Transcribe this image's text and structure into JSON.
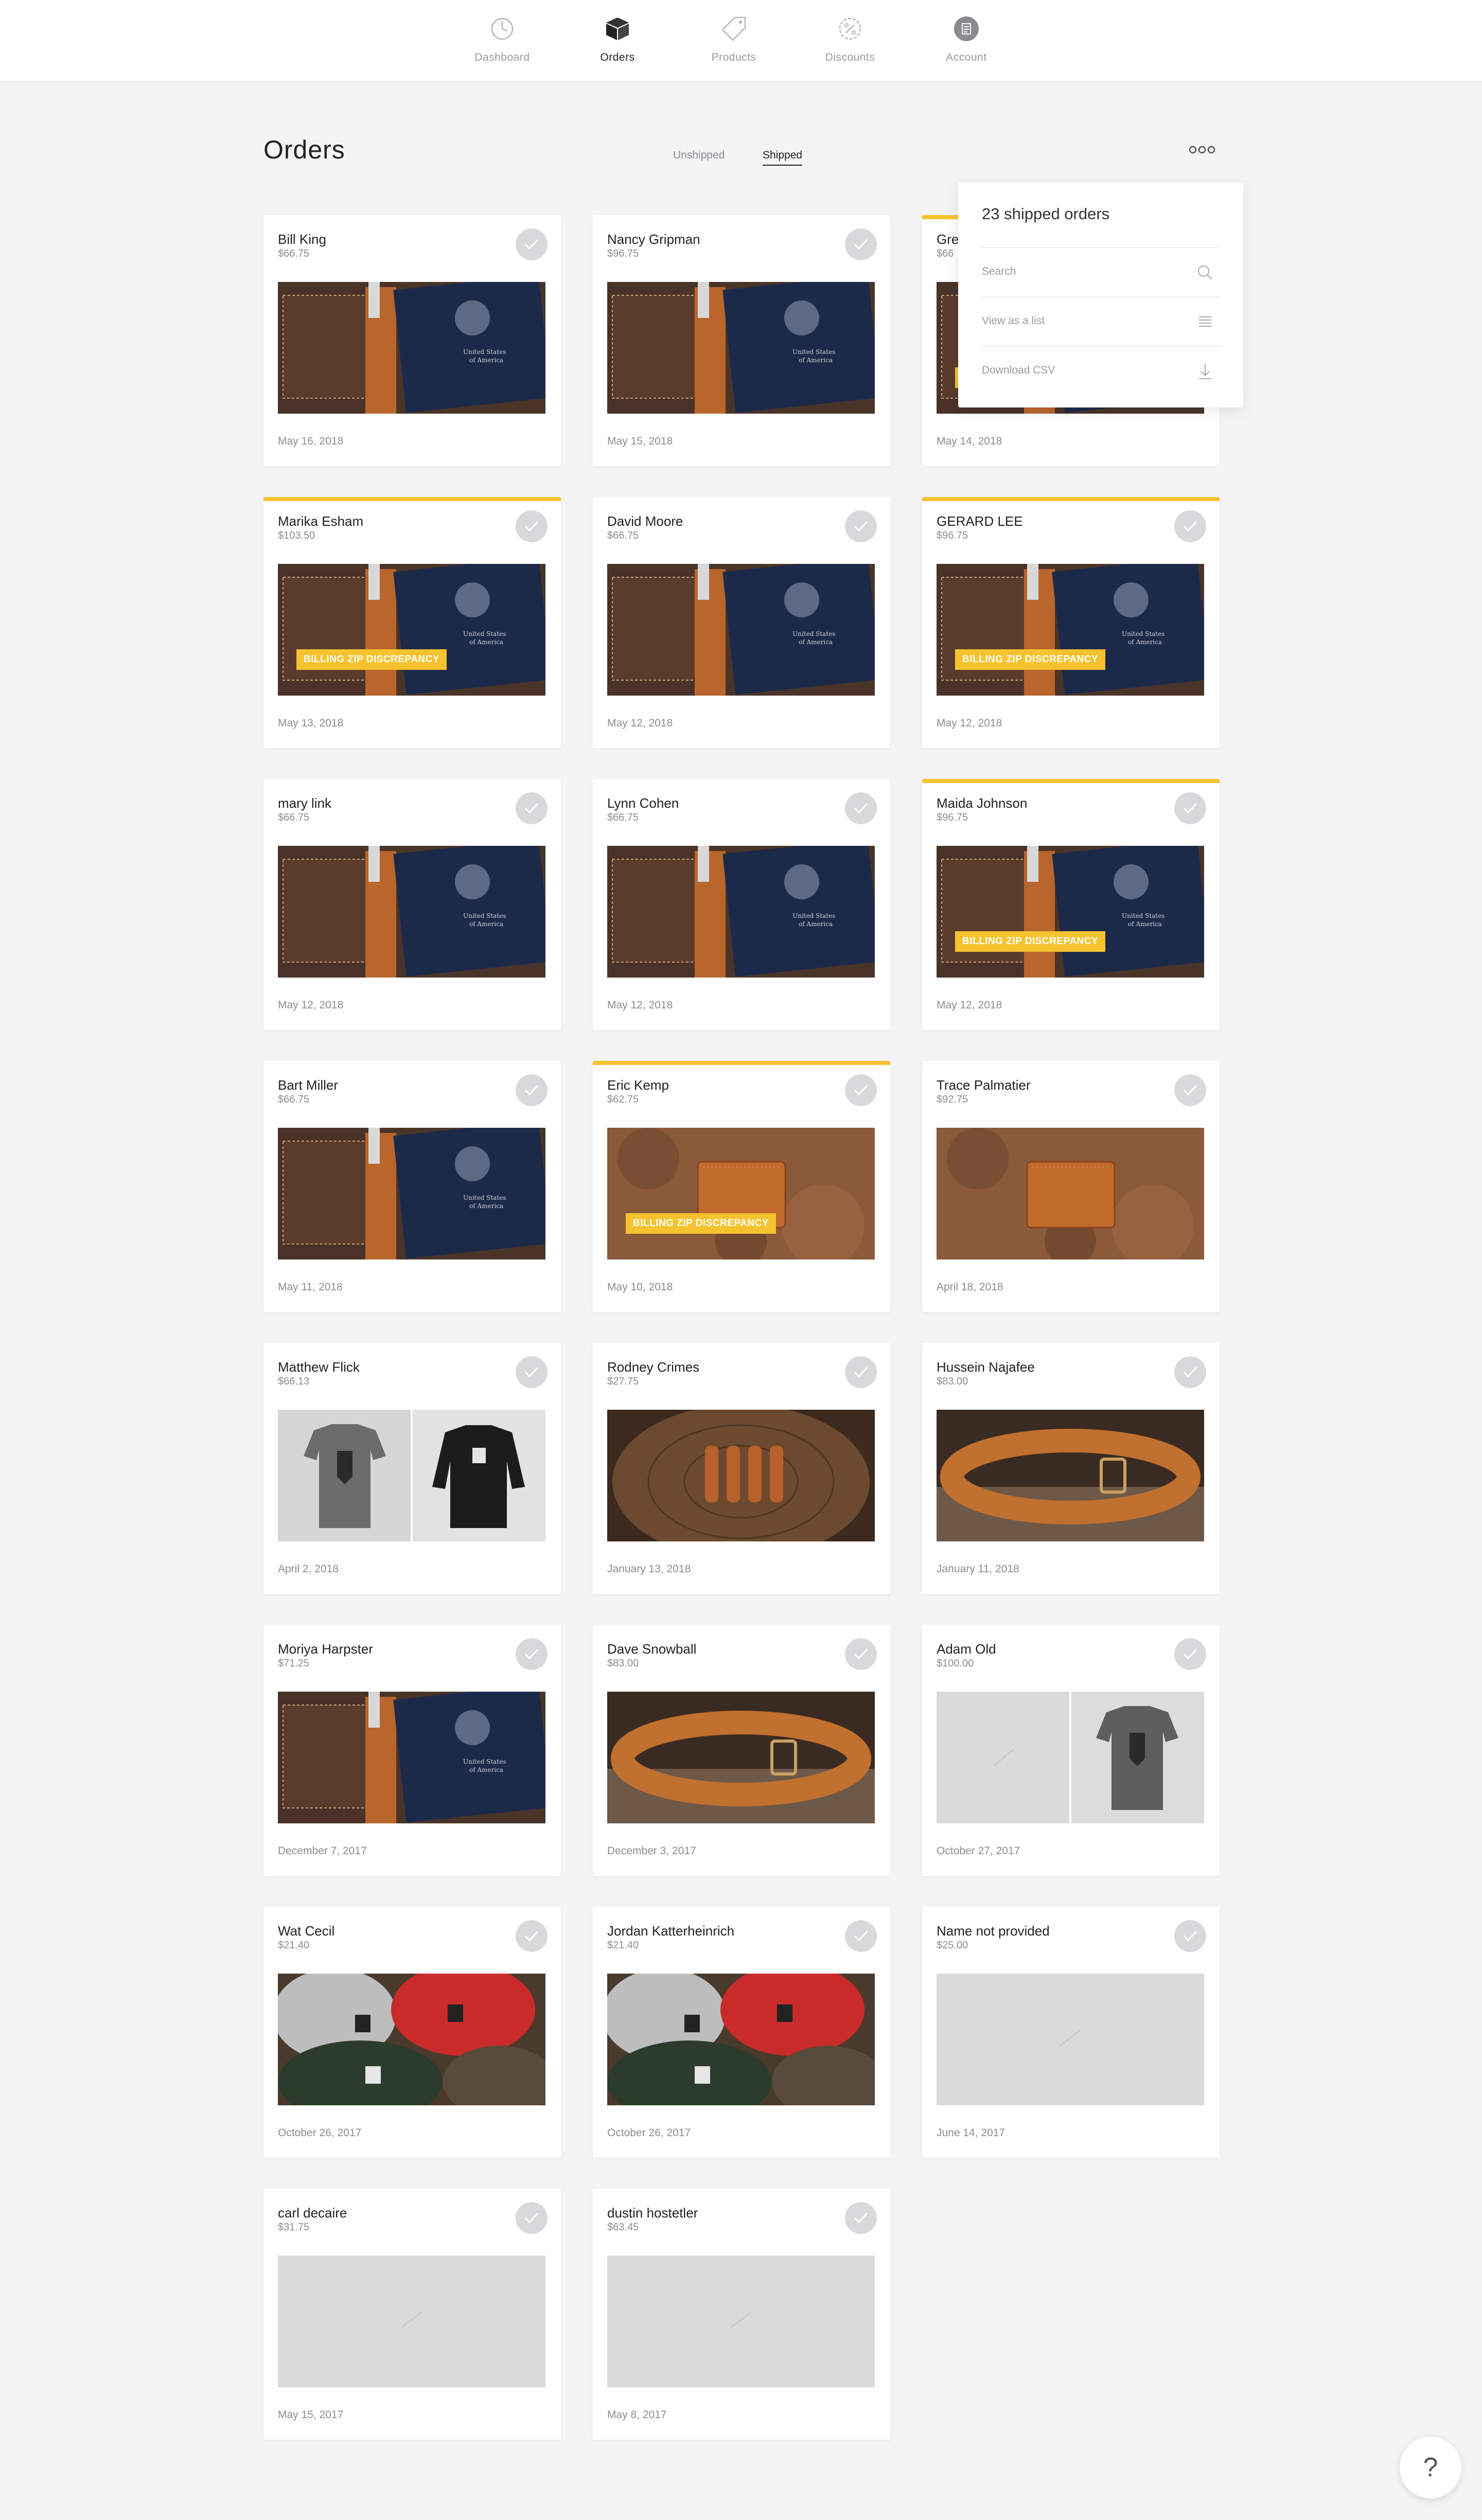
{
  "nav": {
    "items": [
      {
        "label": "Dashboard",
        "icon": "dashboard-icon",
        "active": false
      },
      {
        "label": "Orders",
        "icon": "box-icon",
        "active": true
      },
      {
        "label": "Products",
        "icon": "tag-icon",
        "active": false
      },
      {
        "label": "Discounts",
        "icon": "discount-icon",
        "active": false
      },
      {
        "label": "Account",
        "icon": "account-icon",
        "active": false
      }
    ]
  },
  "page": {
    "title": "Orders",
    "tabs": [
      {
        "label": "Unshipped",
        "active": false
      },
      {
        "label": "Shipped",
        "active": true
      }
    ],
    "more_icon": "more-icon"
  },
  "dropdown": {
    "title": "23 shipped orders",
    "items": [
      {
        "label": "Search",
        "icon": "search-icon"
      },
      {
        "label": "View as a list",
        "icon": "list-icon"
      },
      {
        "label": "Download CSV",
        "icon": "download-icon"
      }
    ]
  },
  "badge_text": "BILLING ZIP DISCREPANCY",
  "accent_color": "#f6c32f",
  "orders": [
    {
      "name": "Bill King",
      "price": "$66.75",
      "date": "May 16, 2018",
      "image": "passport-wallet",
      "flag": false
    },
    {
      "name": "Nancy Gripman",
      "price": "$96.75",
      "date": "May 15, 2018",
      "image": "passport-wallet",
      "flag": false
    },
    {
      "name": "Gre",
      "price": "$66",
      "date": "May 14, 2018",
      "image": "passport-wallet",
      "flag": true
    },
    {
      "name": "Marika Esham",
      "price": "$103.50",
      "date": "May 13, 2018",
      "image": "passport-wallet",
      "flag": true
    },
    {
      "name": "David Moore",
      "price": "$66.75",
      "date": "May 12, 2018",
      "image": "passport-wallet",
      "flag": false
    },
    {
      "name": "GERARD LEE",
      "price": "$96.75",
      "date": "May 12, 2018",
      "image": "passport-wallet",
      "flag": true
    },
    {
      "name": "mary link",
      "price": "$66.75",
      "date": "May 12, 2018",
      "image": "passport-wallet",
      "flag": false
    },
    {
      "name": "Lynn Cohen",
      "price": "$66.75",
      "date": "May 12, 2018",
      "image": "passport-wallet",
      "flag": false
    },
    {
      "name": "Maida Johnson",
      "price": "$96.75",
      "date": "May 12, 2018",
      "image": "passport-wallet",
      "flag": true
    },
    {
      "name": "Bart Miller",
      "price": "$66.75",
      "date": "May 11, 2018",
      "image": "passport-wallet",
      "flag": false
    },
    {
      "name": "Eric Kemp",
      "price": "$62.75",
      "date": "May 10, 2018",
      "image": "bifold-wallet",
      "flag": true
    },
    {
      "name": "Trace Palmatier",
      "price": "$92.75",
      "date": "April 18, 2018",
      "image": "bifold-wallet",
      "flag": false
    },
    {
      "name": "Matthew Flick",
      "price": "$66.13",
      "date": "April 2, 2018",
      "image": "shirt-sweater",
      "flag": false
    },
    {
      "name": "Rodney Crimes",
      "price": "$27.75",
      "date": "January 13, 2018",
      "image": "keychains",
      "flag": false
    },
    {
      "name": "Hussein Najafee",
      "price": "$83.00",
      "date": "January 11, 2018",
      "image": "belt",
      "flag": false
    },
    {
      "name": "Moriya Harpster",
      "price": "$71.25",
      "date": "December 7, 2017",
      "image": "passport-wallet",
      "flag": false
    },
    {
      "name": "Dave Snowball",
      "price": "$83.00",
      "date": "December 3, 2017",
      "image": "belt",
      "flag": false
    },
    {
      "name": "Adam Old",
      "price": "$100.00",
      "date": "October 27, 2017",
      "image": "placeholder-shirt",
      "flag": false
    },
    {
      "name": "Wat Cecil",
      "price": "$21.40",
      "date": "October 26, 2017",
      "image": "beanies",
      "flag": false
    },
    {
      "name": "Jordan Katterheinrich",
      "price": "$21.40",
      "date": "October 26, 2017",
      "image": "beanies",
      "flag": false
    },
    {
      "name": "Name not provided",
      "price": "$25.00",
      "date": "June 14, 2017",
      "image": "placeholder",
      "flag": false
    },
    {
      "name": "carl decaire",
      "price": "$31.75",
      "date": "May 15, 2017",
      "image": "placeholder",
      "flag": false
    },
    {
      "name": "dustin hostetler",
      "price": "$63.45",
      "date": "May 8, 2017",
      "image": "placeholder",
      "flag": false
    }
  ],
  "help": {
    "label": "?"
  }
}
